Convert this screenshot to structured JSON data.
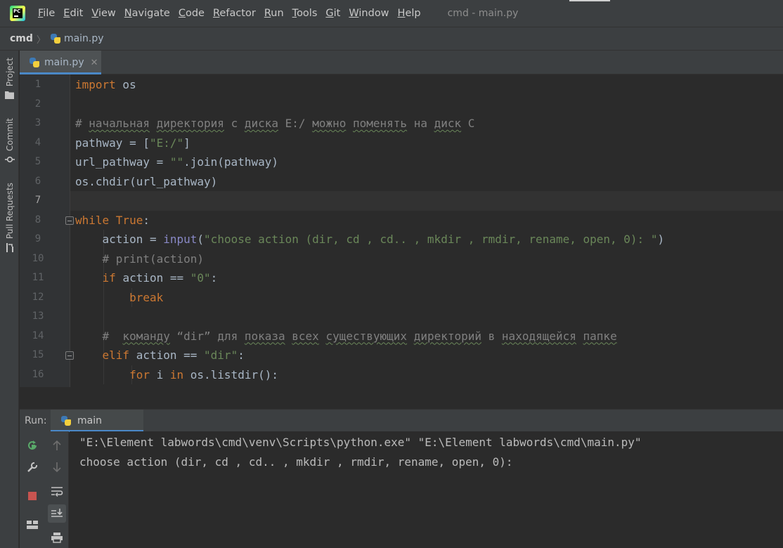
{
  "window": {
    "title": "cmd - main.py"
  },
  "menu": [
    {
      "u": "F",
      "rest": "ile"
    },
    {
      "u": "E",
      "rest": "dit"
    },
    {
      "u": "V",
      "rest": "iew"
    },
    {
      "u": "N",
      "rest": "avigate"
    },
    {
      "u": "C",
      "rest": "ode"
    },
    {
      "u": "R",
      "rest": "efactor"
    },
    {
      "u": "R",
      "rest": "un"
    },
    {
      "u": "T",
      "rest": "ools"
    },
    {
      "u": "G",
      "rest": "it"
    },
    {
      "u": "W",
      "rest": "indow"
    },
    {
      "u": "H",
      "rest": "elp"
    }
  ],
  "app_logo_text": "PC",
  "breadcrumb": {
    "project": "cmd",
    "separator": "〉",
    "file": "main.py"
  },
  "tool_windows": [
    {
      "label": "Project",
      "icon": "folder-icon"
    },
    {
      "label": "Commit",
      "icon": "commit-icon"
    },
    {
      "label": "Pull Requests",
      "icon": "pull-request-icon"
    }
  ],
  "editor": {
    "tab": {
      "label": "main.py",
      "close": "✕"
    },
    "current_line": 7,
    "line_numbers": [
      "1",
      "2",
      "3",
      "4",
      "5",
      "6",
      "7",
      "8",
      "9",
      "10",
      "11",
      "12",
      "13",
      "14",
      "15",
      "16"
    ],
    "lines": [
      [
        {
          "t": "import",
          "c": "kw"
        },
        {
          "t": " os"
        }
      ],
      [],
      [
        {
          "t": "# ",
          "c": "cm"
        },
        {
          "t": "начальная",
          "c": "cm typo"
        },
        {
          "t": " ",
          "c": "cm"
        },
        {
          "t": "директория",
          "c": "cm typo"
        },
        {
          "t": " с ",
          "c": "cm"
        },
        {
          "t": "диска",
          "c": "cm typo"
        },
        {
          "t": " E:/ ",
          "c": "cm"
        },
        {
          "t": "можно",
          "c": "cm typo"
        },
        {
          "t": " ",
          "c": "cm"
        },
        {
          "t": "поменять",
          "c": "cm typo"
        },
        {
          "t": " на ",
          "c": "cm"
        },
        {
          "t": "диск",
          "c": "cm typo"
        },
        {
          "t": " C",
          "c": "cm"
        }
      ],
      [
        {
          "t": "pathway = ["
        },
        {
          "t": "\"E:/\"",
          "c": "str"
        },
        {
          "t": "]"
        }
      ],
      [
        {
          "t": "url_pathway = "
        },
        {
          "t": "\"\"",
          "c": "str"
        },
        {
          "t": ".join(pathway)"
        }
      ],
      [
        {
          "t": "os.chdir(url_pathway)"
        }
      ],
      [],
      [
        {
          "t": "while ",
          "c": "kw"
        },
        {
          "t": "True",
          "c": "kw"
        },
        {
          "t": ":"
        }
      ],
      [
        {
          "t": "    action = "
        },
        {
          "t": "input",
          "c": "bi"
        },
        {
          "t": "("
        },
        {
          "t": "\"choose action (dir, cd , cd.. , mkdir , rmdir, rename, open, 0): \"",
          "c": "str"
        },
        {
          "t": ")"
        }
      ],
      [
        {
          "t": "    # print(action)",
          "c": "cm"
        }
      ],
      [
        {
          "t": "    "
        },
        {
          "t": "if ",
          "c": "kw"
        },
        {
          "t": "action == "
        },
        {
          "t": "\"0\"",
          "c": "str"
        },
        {
          "t": ":"
        }
      ],
      [
        {
          "t": "        "
        },
        {
          "t": "break",
          "c": "kw"
        }
      ],
      [],
      [
        {
          "t": "    #  ",
          "c": "cm"
        },
        {
          "t": "команду",
          "c": "cm typo"
        },
        {
          "t": " “dir” для ",
          "c": "cm"
        },
        {
          "t": "показа",
          "c": "cm typo"
        },
        {
          "t": " ",
          "c": "cm"
        },
        {
          "t": "всех",
          "c": "cm typo"
        },
        {
          "t": " ",
          "c": "cm"
        },
        {
          "t": "существующих",
          "c": "cm typo"
        },
        {
          "t": " ",
          "c": "cm"
        },
        {
          "t": "директорий",
          "c": "cm typo"
        },
        {
          "t": " в ",
          "c": "cm"
        },
        {
          "t": "находящейся",
          "c": "cm typo"
        },
        {
          "t": " ",
          "c": "cm"
        },
        {
          "t": "папке",
          "c": "cm typo"
        }
      ],
      [
        {
          "t": "    "
        },
        {
          "t": "elif ",
          "c": "kw"
        },
        {
          "t": "action == "
        },
        {
          "t": "\"dir\"",
          "c": "str"
        },
        {
          "t": ":"
        }
      ],
      [
        {
          "t": "        "
        },
        {
          "t": "for ",
          "c": "kw"
        },
        {
          "t": "i "
        },
        {
          "t": "in ",
          "c": "kw"
        },
        {
          "t": "os.listdir():"
        }
      ]
    ]
  },
  "run": {
    "label": "Run:",
    "tab_label": "main",
    "console_lines": [
      "\"E:\\Element labwords\\cmd\\venv\\Scripts\\python.exe\" \"E:\\Element labwords\\cmd\\main.py\"",
      "choose action (dir, cd , cd.. , mkdir , rmdir, rename, open, 0): "
    ]
  },
  "colors": {
    "keyword": "#cc7832",
    "string": "#6a8759",
    "comment": "#808080",
    "builtin": "#8888c6",
    "accent": "#4a88c7",
    "stop": "#c75450",
    "rerun": "#59a869"
  }
}
